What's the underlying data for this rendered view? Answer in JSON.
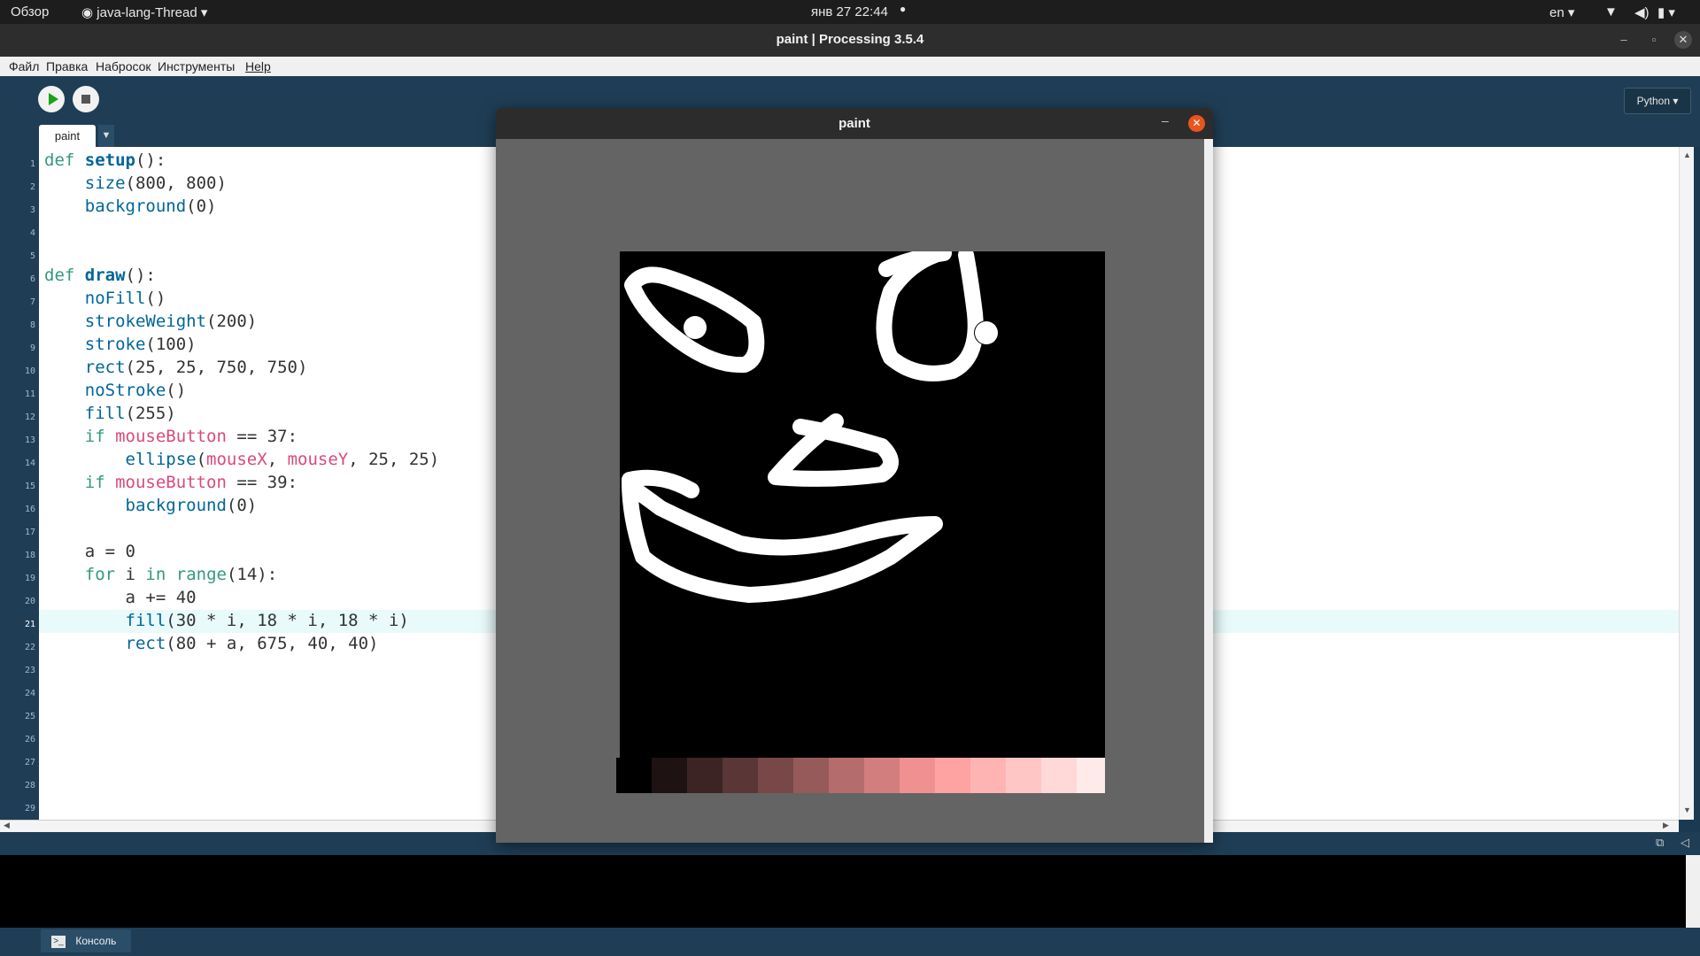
{
  "topbar": {
    "overview": "Обзор",
    "app_menu": "java-lang-Thread",
    "datetime": "янв 27  22:44",
    "lang": "en"
  },
  "window": {
    "title": "paint | Processing 3.5.4"
  },
  "menu": [
    "Файл",
    "Правка",
    "Набросок",
    "Инструменты",
    "Help"
  ],
  "toolbar": {
    "mode": "Python ▾"
  },
  "tabs": [
    {
      "label": "paint"
    }
  ],
  "editor": {
    "current_line": 21,
    "line_numbers": [
      "1",
      "2",
      "3",
      "4",
      "5",
      "6",
      "7",
      "8",
      "9",
      "10",
      "11",
      "12",
      "13",
      "14",
      "15",
      "16",
      "17",
      "18",
      "19",
      "20",
      "21",
      "22",
      "23",
      "24",
      "25",
      "26",
      "27",
      "28",
      "29"
    ]
  },
  "console": {
    "tab_label": "Консоль"
  },
  "sketch_window": {
    "title": "paint",
    "swatch_colors": [
      "#000000",
      "#1e1212",
      "#3c2424",
      "#5a3636",
      "#784848",
      "#965a5a",
      "#b46c6c",
      "#d27e7e",
      "#f09090",
      "#ffa2a2",
      "#ffb4b4",
      "#ffc6c6",
      "#ffd8d8",
      "#ffeaea"
    ]
  },
  "colors": {
    "accent": "#e95420",
    "editor_bg": "#ffffff",
    "ide_bg": "#1f3e56"
  }
}
